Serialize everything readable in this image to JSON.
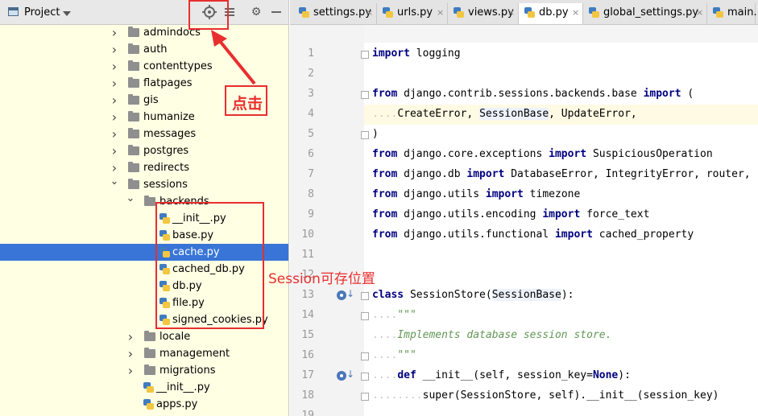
{
  "project_panel": {
    "title": "Project",
    "icons": [
      "locate-icon",
      "collapse-icon",
      "gear-icon",
      "hide-icon"
    ]
  },
  "tree": [
    {
      "label": "admindocs",
      "kind": "folder",
      "depth": 1,
      "expanded": false
    },
    {
      "label": "auth",
      "kind": "folder",
      "depth": 1,
      "expanded": false
    },
    {
      "label": "contenttypes",
      "kind": "folder",
      "depth": 1,
      "expanded": false
    },
    {
      "label": "flatpages",
      "kind": "folder",
      "depth": 1,
      "expanded": false
    },
    {
      "label": "gis",
      "kind": "folder",
      "depth": 1,
      "expanded": false
    },
    {
      "label": "humanize",
      "kind": "folder",
      "depth": 1,
      "expanded": false
    },
    {
      "label": "messages",
      "kind": "folder",
      "depth": 1,
      "expanded": false
    },
    {
      "label": "postgres",
      "kind": "folder",
      "depth": 1,
      "expanded": false
    },
    {
      "label": "redirects",
      "kind": "folder",
      "depth": 1,
      "expanded": false
    },
    {
      "label": "sessions",
      "kind": "folder",
      "depth": 1,
      "expanded": true
    },
    {
      "label": "backends",
      "kind": "folder",
      "depth": 2,
      "expanded": true
    },
    {
      "label": "__init__.py",
      "kind": "py",
      "depth": 3
    },
    {
      "label": "base.py",
      "kind": "py",
      "depth": 3
    },
    {
      "label": "cache.py",
      "kind": "py",
      "depth": 3,
      "selected": true
    },
    {
      "label": "cached_db.py",
      "kind": "py",
      "depth": 3
    },
    {
      "label": "db.py",
      "kind": "py",
      "depth": 3
    },
    {
      "label": "file.py",
      "kind": "py",
      "depth": 3
    },
    {
      "label": "signed_cookies.py",
      "kind": "py",
      "depth": 3
    },
    {
      "label": "locale",
      "kind": "folder",
      "depth": 2,
      "expanded": false
    },
    {
      "label": "management",
      "kind": "folder",
      "depth": 2,
      "expanded": false
    },
    {
      "label": "migrations",
      "kind": "folder",
      "depth": 2,
      "expanded": false
    },
    {
      "label": "__init__.py",
      "kind": "py",
      "depth": 2
    },
    {
      "label": "apps.py",
      "kind": "py",
      "depth": 2
    }
  ],
  "tabs": [
    {
      "label": "settings.py",
      "active": false
    },
    {
      "label": "urls.py",
      "active": false
    },
    {
      "label": "views.py",
      "active": false
    },
    {
      "label": "db.py",
      "active": true
    },
    {
      "label": "global_settings.py",
      "active": false
    },
    {
      "label": "main.",
      "active": false
    }
  ],
  "tab_close_glyph": "×",
  "code_lines": [
    {
      "n": "1",
      "html": "<span class=\"kw\">import</span> logging"
    },
    {
      "n": "2",
      "html": ""
    },
    {
      "n": "3",
      "html": "<span class=\"kw\">from</span> django.contrib.sessions.backends.base <span class=\"kw\">import</span> ("
    },
    {
      "n": "4",
      "html": "<span class=\"dots\">....</span>CreateError, <span class=\"ref\">SessionBase</span>, UpdateError,",
      "current": true
    },
    {
      "n": "5",
      "html": ")"
    },
    {
      "n": "6",
      "html": "<span class=\"kw\">from</span> django.core.exceptions <span class=\"kw\">import</span> SuspiciousOperation"
    },
    {
      "n": "7",
      "html": "<span class=\"kw\">from</span> django.db <span class=\"kw\">import</span> DatabaseError, IntegrityError, router,"
    },
    {
      "n": "8",
      "html": "<span class=\"kw\">from</span> django.utils <span class=\"kw\">import</span> timezone"
    },
    {
      "n": "9",
      "html": "<span class=\"kw\">from</span> django.utils.encoding <span class=\"kw\">import</span> force_text"
    },
    {
      "n": "10",
      "html": "<span class=\"kw\">from</span> django.utils.functional <span class=\"kw\">import</span> cached_property"
    },
    {
      "n": "11",
      "html": ""
    },
    {
      "n": "12",
      "html": ""
    },
    {
      "n": "13",
      "html": "<span class=\"kw\">class</span> SessionStore(<span class=\"ref\">SessionBase</span>):"
    },
    {
      "n": "14",
      "html": "<span class=\"dots\">....</span><span class=\"doc\">\"\"\"</span>"
    },
    {
      "n": "15",
      "html": "<span class=\"dots\">....</span><span class=\"doc\">Implements database session store.</span>"
    },
    {
      "n": "16",
      "html": "<span class=\"dots\">....</span><span class=\"doc\">\"\"\"</span>"
    },
    {
      "n": "17",
      "html": "<span class=\"dots\">....</span><span class=\"kw\">def</span> __init__(self, session_key=<span class=\"kw\">None</span>):"
    },
    {
      "n": "18",
      "html": "<span class=\"dots\">........</span>super(SessionStore, self).__init__(session_key)"
    },
    {
      "n": "19",
      "html": ""
    }
  ],
  "annotations": {
    "click_label": "点击",
    "session_label": "Session可存位置"
  },
  "colors": {
    "annotation": "#e82e2e",
    "selection": "#3875d7",
    "keyword": "#000080",
    "docstring": "#629755"
  }
}
